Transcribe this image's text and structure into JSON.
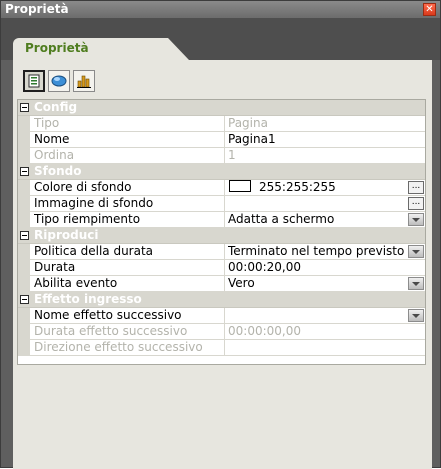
{
  "window": {
    "title": "Proprietà",
    "close_glyph": "✕"
  },
  "tab": {
    "label": "Proprietà"
  },
  "toolbar": {
    "buttons": [
      "properties-page-icon",
      "shape-3d-icon",
      "chart-icon"
    ]
  },
  "grid": {
    "config": {
      "label": "Config",
      "rows": [
        {
          "name": "Tipo",
          "value": "Pagina"
        },
        {
          "name": "Nome",
          "value": "Pagina1"
        },
        {
          "name": "Ordina",
          "value": "1"
        }
      ]
    },
    "sfondo": {
      "label": "Sfondo",
      "rows": [
        {
          "name": "Colore di sfondo",
          "value": "255:255:255"
        },
        {
          "name": "Immagine di sfondo",
          "value": ""
        },
        {
          "name": "Tipo riempimento",
          "value": "Adatta a schermo"
        }
      ]
    },
    "riproduci": {
      "label": "Riproduci",
      "rows": [
        {
          "name": "Politica della durata",
          "value": "Terminato nel tempo previsto"
        },
        {
          "name": "Durata",
          "value": "00:00:20,00"
        },
        {
          "name": "Abilita evento",
          "value": "Vero"
        }
      ]
    },
    "effetto": {
      "label": "Effetto ingresso",
      "rows": [
        {
          "name": "Nome effetto successivo",
          "value": ""
        },
        {
          "name": "Durata effetto successivo",
          "value": "00:00:00,00"
        },
        {
          "name": "Direzione effetto successivo",
          "value": ""
        }
      ]
    }
  },
  "ellipsis_label": "..."
}
